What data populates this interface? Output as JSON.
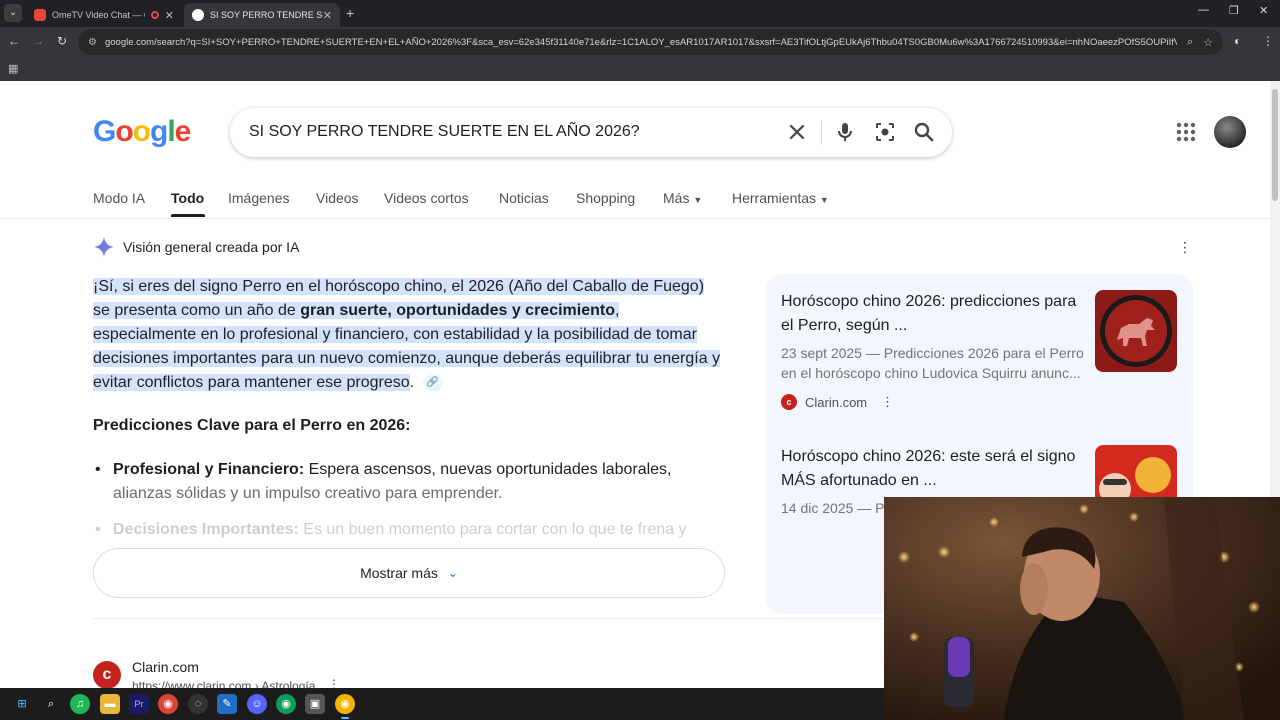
{
  "browser": {
    "tabs": [
      {
        "title": "OmeTV Video Chat — Ome",
        "active": false
      },
      {
        "title": "SI SOY PERRO TENDRE SUERTE",
        "active": true
      }
    ],
    "url": "google.com/search?q=SI+SOY+PERRO+TENDRE+SUERTE+EN+EL+AÑO+2026%3F&sca_esv=62e345f31140e71e&rlz=1C1ALOY_esAR1017AR1017&sxsrf=AE3TifOLtjGpEUkAj6Thbu04TS0GB0Mu6w%3A1766724510993&ei=nhNOaeezPOfS5OUPiIfV2AI&ved=0..."
  },
  "search": {
    "logo_letters": [
      "G",
      "o",
      "o",
      "g",
      "l",
      "e"
    ],
    "query": "SI SOY PERRO TENDRE SUERTE EN EL AÑO 2026?"
  },
  "nav_tabs": [
    "Modo IA",
    "Todo",
    "Imágenes",
    "Videos",
    "Videos cortos",
    "Noticias",
    "Shopping",
    "Más",
    "Herramientas"
  ],
  "ai_overview": {
    "header": "Visión general creada por IA",
    "p1_a": "¡Sí, si eres del signo Perro en el horóscopo chino, el 2026 (Año del Caballo de Fuego) se presenta como un año de ",
    "p1_bold": "gran suerte, oportunidades y crecimiento",
    "p1_b": ", especialmente en lo profesional y financiero, con estabilidad y la posibilidad de tomar decisiones importantes para un nuevo comienzo, aunque deberás equilibrar tu energía y evitar conflictos para mantener ese progreso",
    "p1_end": ".",
    "predictions_heading": "Predicciones Clave para el Perro en 2026:",
    "bullets": [
      {
        "bold": "Profesional y Financiero:",
        "text": " Espera ascensos, nuevas oportunidades laborales, ",
        "text2": "alianzas sólidas y un impulso creativo para emprender."
      },
      {
        "bold": "Decisiones Importantes:",
        "text": " Es un buen momento para cortar con lo que te frena y",
        "text2": ""
      }
    ],
    "show_more": "Mostrar más"
  },
  "sources": [
    {
      "title": "Horóscopo chino 2026: predicciones para el Perro, según ...",
      "snippet": "23 sept 2025 — Predicciones 2026 para el Perro en el horóscopo chino Ludovica Squirru anunc...",
      "site": "Clarin.com"
    },
    {
      "title": "Horóscopo chino 2026: este será el signo MÁS afortunado en ...",
      "snippet": "14 dic 2025 — Po...",
      "site": ""
    }
  ],
  "result": {
    "site": "Clarin.com",
    "url": "https://www.clarin.com › Astrología"
  },
  "colors": {
    "google_blue": "#4285f4",
    "google_red": "#ea4335",
    "google_yellow": "#fbbc05",
    "google_green": "#34a853",
    "highlight": "#d3e3fd",
    "clarin_red": "#c5221f"
  }
}
